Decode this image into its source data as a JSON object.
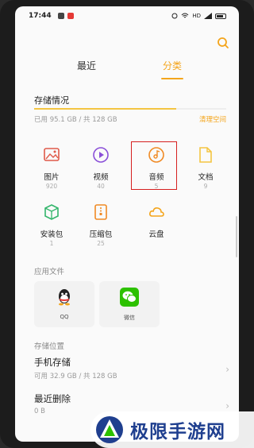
{
  "status_bar": {
    "time": "17:44",
    "network": "HD",
    "battery_level": 0.7
  },
  "tabs": [
    {
      "label": "最近",
      "active": false
    },
    {
      "label": "分类",
      "active": true
    }
  ],
  "storage": {
    "title": "存储情况",
    "used_text": "已用 95.1 GB / 共 128 GB",
    "clean_label": "清理空间",
    "used_fraction": 0.74
  },
  "categories": [
    {
      "label": "图片",
      "count": "920",
      "icon": "image-icon"
    },
    {
      "label": "视频",
      "count": "40",
      "icon": "video-icon"
    },
    {
      "label": "音频",
      "count": "5",
      "icon": "audio-icon"
    },
    {
      "label": "文档",
      "count": "9",
      "icon": "document-icon"
    },
    {
      "label": "安装包",
      "count": "1",
      "icon": "package-icon"
    },
    {
      "label": "压缩包",
      "count": "25",
      "icon": "archive-icon"
    },
    {
      "label": "云盘",
      "count": "",
      "icon": "cloud-icon"
    }
  ],
  "apps_section": {
    "title": "应用文件",
    "apps": [
      {
        "label": "QQ",
        "icon": "qq-icon"
      },
      {
        "label": "微信",
        "icon": "wechat-icon"
      }
    ]
  },
  "storage_location": {
    "title": "存储位置",
    "items": [
      {
        "title": "手机存储",
        "sub": "可用 32.9 GB / 共 128 GB"
      },
      {
        "title": "最近删除",
        "sub": "0 B"
      }
    ]
  },
  "watermark": {
    "text": "极限手游网"
  },
  "colors": {
    "accent": "#f4a51c",
    "highlight": "#d61f1f"
  }
}
